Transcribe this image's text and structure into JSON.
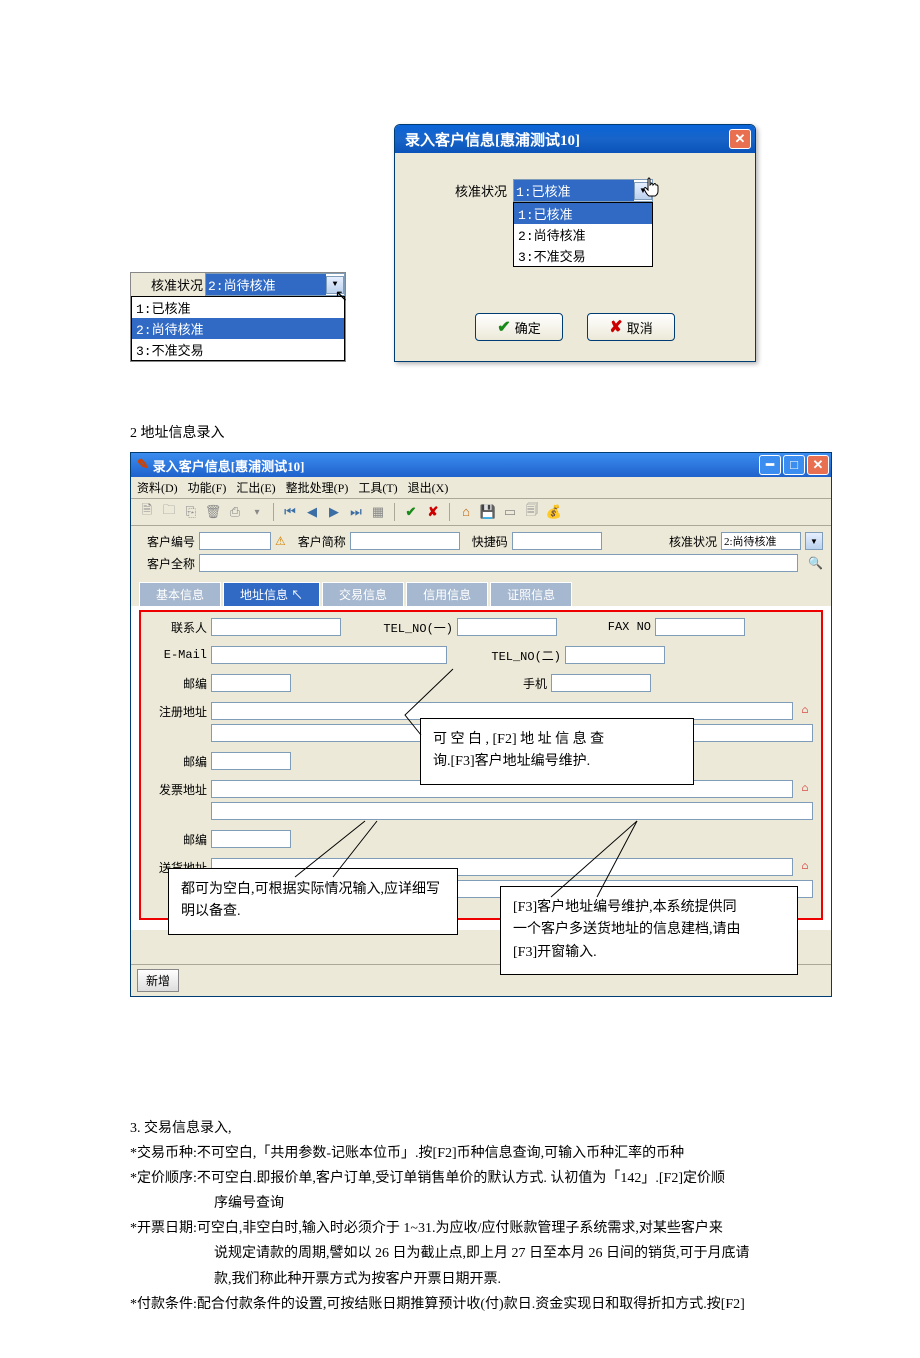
{
  "dialog": {
    "title": "录入客户信息[惠浦测试10]",
    "field_label": "核准状况",
    "selected": "1:已核准",
    "options": [
      "1:已核准",
      "2:尚待核准",
      "3:不准交易"
    ],
    "ok": "确定",
    "cancel": "取消"
  },
  "small": {
    "field_label": "核准状况",
    "selected": "2:尚待核准",
    "options": [
      "1:已核准",
      "2:尚待核准",
      "3:不准交易"
    ]
  },
  "sec2_heading": "2 地址信息录入",
  "app": {
    "title": "录入客户信息[惠浦测试10]",
    "menu": [
      "资料(D)",
      "功能(F)",
      "汇出(E)",
      "整批处理(P)",
      "工具(T)",
      "退出(X)"
    ],
    "labels": {
      "cust_no": "客户编号",
      "cust_short": "客户简称",
      "quick_code": "快捷码",
      "approve": "核准状况",
      "approve_val": "2:尚待核准",
      "cust_full": "客户全称"
    },
    "tabs": [
      "基本信息",
      "地址信息",
      "交易信息",
      "信用信息",
      "证照信息"
    ],
    "form": {
      "contact": "联系人",
      "tel1": "TEL_NO(一)",
      "fax": "FAX NO",
      "email": "E-Mail",
      "tel2": "TEL_NO(二)",
      "zip": "邮编",
      "mobile": "手机",
      "reg_addr": "注册地址",
      "inv_addr": "发票地址",
      "ship_addr": "送货地址"
    },
    "status_btn": "新增"
  },
  "callouts": {
    "c1_l1": "可 空 白 , [F2] 地 址 信 息 查",
    "c1_l2": "询.[F3]客户地址编号维护.",
    "c2": "都可为空白,可根据实际情况输入,应详细写明以备查.",
    "c3_l1": "[F3]客户地址编号维护,本系统提供同",
    "c3_l2": "一个客户多送货地址的信息建档,请由",
    "c3_l3": "[F3]开窗输入."
  },
  "sec3_heading": "3. 交易信息录入,",
  "body": {
    "l1": "*交易币种:不可空白,「共用参数-记账本位币」.按[F2]币种信息查询,可输入币种汇率的币种",
    "l2a": "*定价顺序:不可空白.即报价单,客户订单,受订单销售单价的默认方式.  认初值为「142」.[F2]定价顺",
    "l2b": "序编号查询",
    "l3a": "*开票日期:可空白,非空白时,输入时必须介于 1~31.为应收/应付账款管理子系统需求,对某些客户来",
    "l3b": "说规定请款的周期,譬如以 26 日为截止点,即上月 27 日至本月 26 日间的销货,可于月底请",
    "l3c": "款,我们称此种开票方式为按客户开票日期开票.",
    "l4": "*付款条件:配合付款条件的设置,可按结账日期推算预计收(付)款日.资金实现日和取得折扣方式.按[F2]"
  }
}
